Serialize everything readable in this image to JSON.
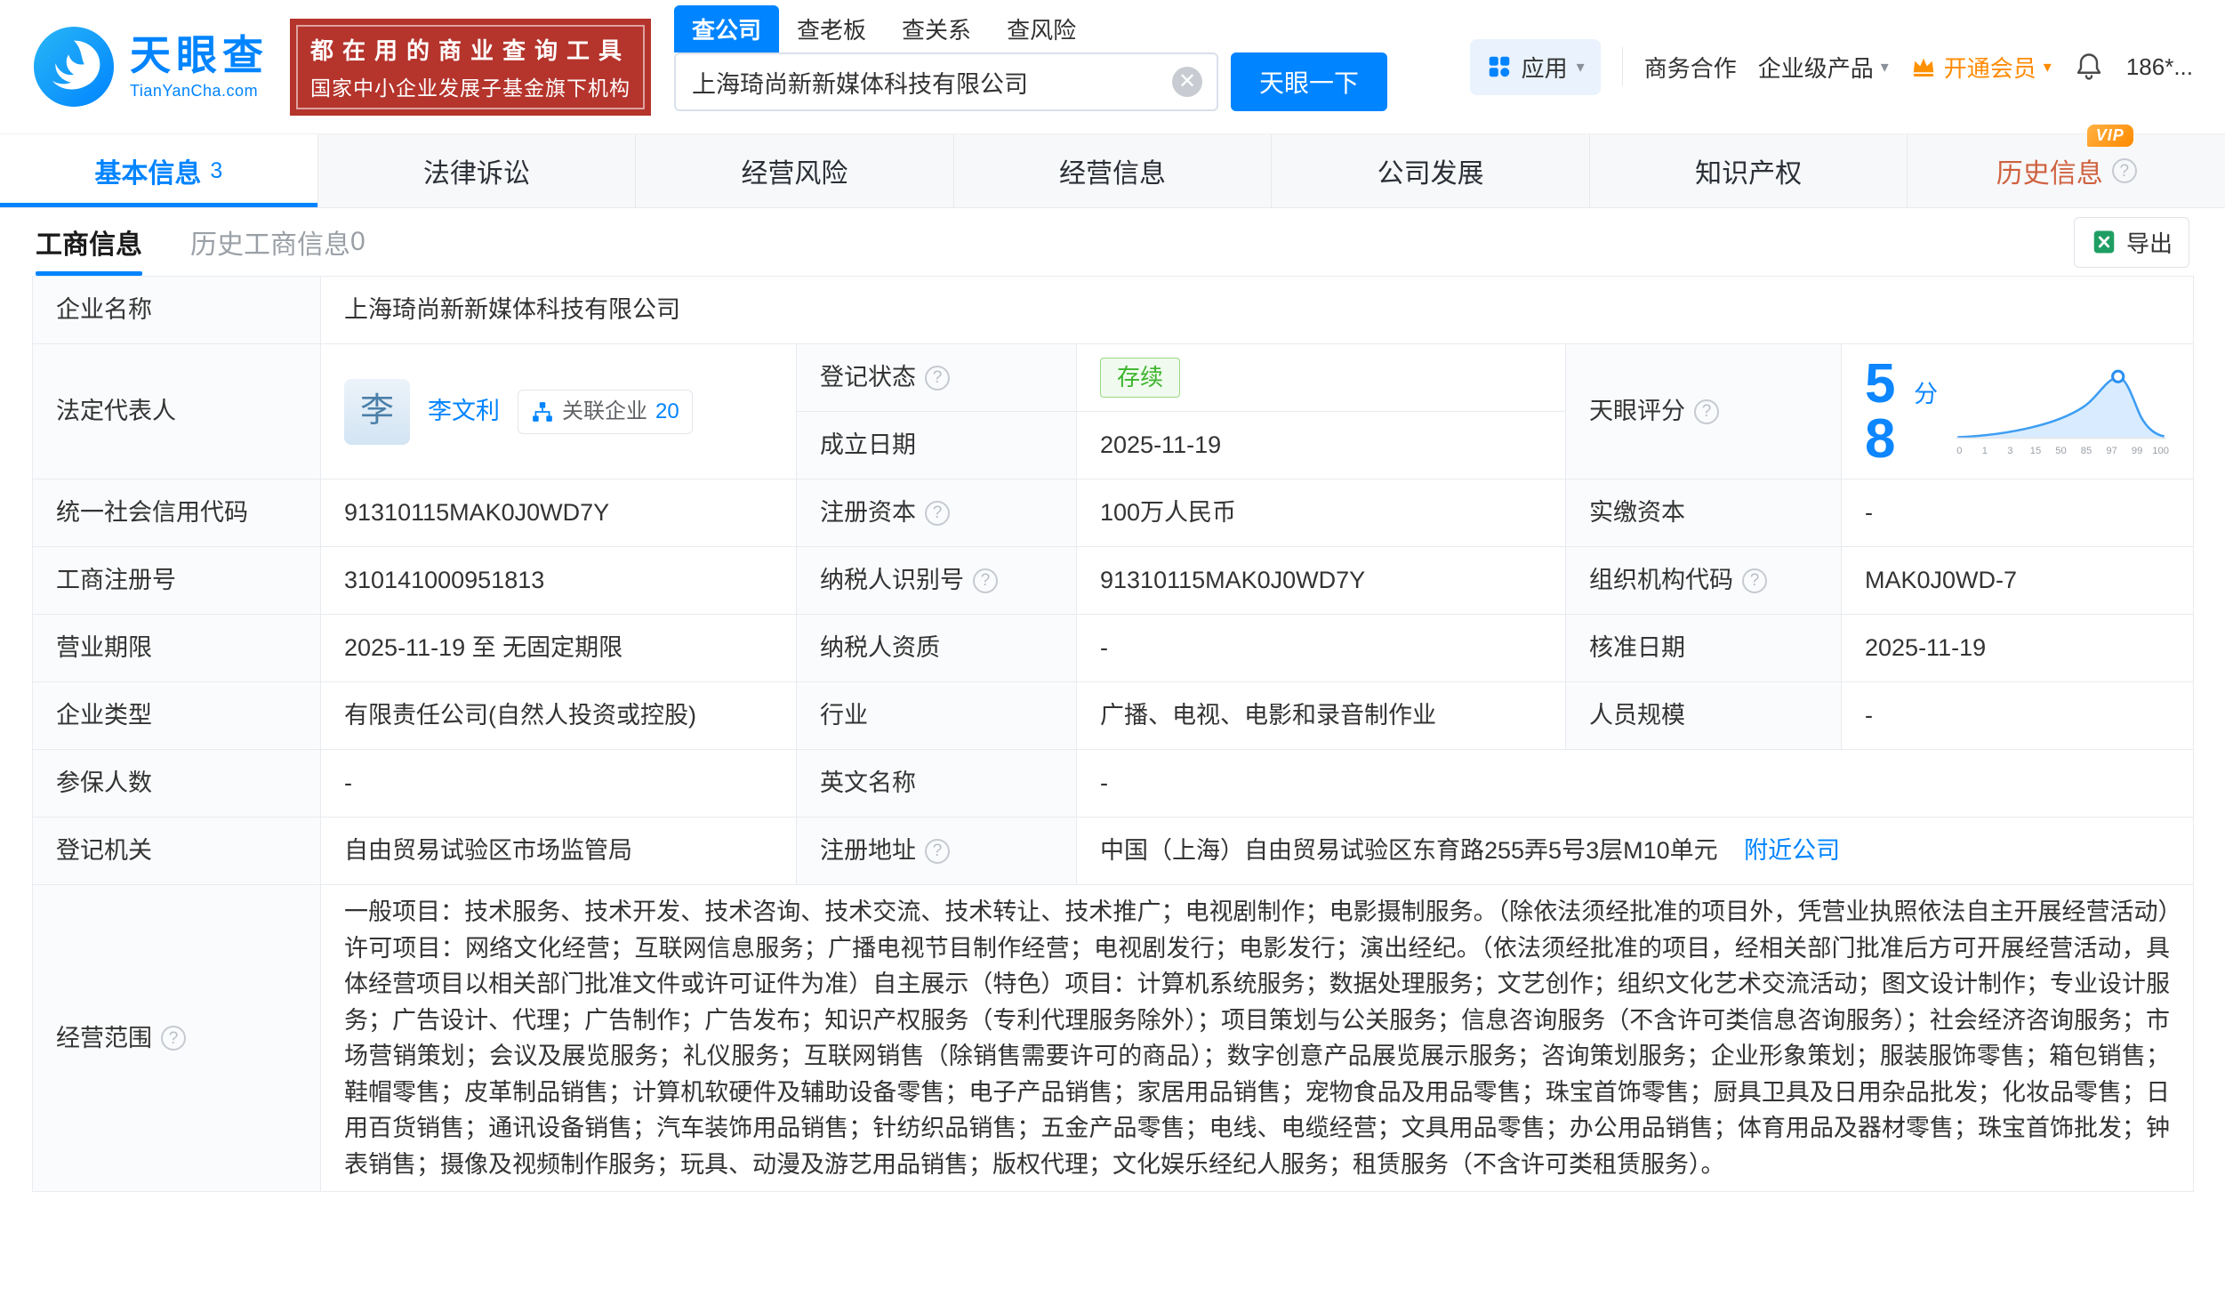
{
  "brand": {
    "name": "天眼查",
    "domain": "TianYanCha.com",
    "slogan_line1": "都在用的商业查询工具",
    "slogan_line2": "国家中小企业发展子基金旗下机构",
    "accent_color": "#0084ff",
    "slogan_bg_color": "#b5342c"
  },
  "icons": {
    "caret_down": "▾",
    "clear": "✕",
    "question": "?"
  },
  "search": {
    "tabs": [
      {
        "label": "查公司",
        "active": true
      },
      {
        "label": "查老板",
        "active": false
      },
      {
        "label": "查关系",
        "active": false
      },
      {
        "label": "查风险",
        "active": false
      }
    ],
    "value": "上海琦尚新新媒体科技有限公司",
    "button": "天眼一下"
  },
  "header_nav": {
    "apps": "应用",
    "cooperation": "商务合作",
    "enterprise_product": "企业级产品",
    "vip": "开通会员",
    "account": "186*..."
  },
  "main_tabs": [
    {
      "label": "基本信息",
      "count": "3",
      "active": true
    },
    {
      "label": "法律诉讼"
    },
    {
      "label": "经营风险"
    },
    {
      "label": "经营信息"
    },
    {
      "label": "公司发展"
    },
    {
      "label": "知识产权"
    },
    {
      "label": "历史信息",
      "badge": "VIP"
    }
  ],
  "sub_tabs": [
    {
      "label": "工商信息",
      "active": true
    },
    {
      "label": "历史工商信息",
      "count": "0",
      "active": false
    }
  ],
  "toolbar": {
    "export_label": "导出"
  },
  "company": {
    "name_label": "企业名称",
    "name": "上海琦尚新新媒体科技有限公司",
    "legal_rep_label": "法定代表人",
    "legal_rep_avatar": "李",
    "legal_rep_name": "李文利",
    "related_label": "关联企业",
    "related_count": "20",
    "reg_status_label": "登记状态",
    "reg_status": "存续",
    "establish_date_label": "成立日期",
    "establish_date": "2025-11-19",
    "score_label": "天眼评分",
    "score_value": "58",
    "score_unit": "分",
    "score_axis": [
      "0",
      "1",
      "3",
      "15",
      "50",
      "85",
      "97",
      "99",
      "100"
    ],
    "credit_code_label": "统一社会信用代码",
    "credit_code": "91310115MAK0J0WD7Y",
    "reg_capital_label": "注册资本",
    "reg_capital": "100万人民币",
    "paid_capital_label": "实缴资本",
    "paid_capital": "-",
    "reg_number_label": "工商注册号",
    "reg_number": "310141000951813",
    "taxpayer_id_label": "纳税人识别号",
    "taxpayer_id": "91310115MAK0J0WD7Y",
    "org_code_label": "组织机构代码",
    "org_code": "MAK0J0WD-7",
    "business_term_label": "营业期限",
    "business_term": "2025-11-19 至 无固定期限",
    "taxpayer_quality_label": "纳税人资质",
    "taxpayer_quality": "-",
    "approval_date_label": "核准日期",
    "approval_date": "2025-11-19",
    "company_type_label": "企业类型",
    "company_type": "有限责任公司(自然人投资或控股)",
    "industry_label": "行业",
    "industry": "广播、电视、电影和录音制作业",
    "staff_size_label": "人员规模",
    "staff_size": "-",
    "insured_label": "参保人数",
    "insured": "-",
    "english_name_label": "英文名称",
    "english_name": "-",
    "reg_authority_label": "登记机关",
    "reg_authority": "自由贸易试验区市场监管局",
    "address_label": "注册地址",
    "address": "中国（上海）自由贸易试验区东育路255弄5号3层M10单元",
    "nearby_link": "附近公司",
    "scope_label": "经营范围",
    "scope": "一般项目：技术服务、技术开发、技术咨询、技术交流、技术转让、技术推广；电视剧制作；电影摄制服务。（除依法须经批准的项目外，凭营业执照依法自主开展经营活动）许可项目：网络文化经营；互联网信息服务；广播电视节目制作经营；电视剧发行；电影发行；演出经纪。（依法须经批准的项目，经相关部门批准后方可开展经营活动，具体经营项目以相关部门批准文件或许可证件为准）自主展示（特色）项目：计算机系统服务；数据处理服务；文艺创作；组织文化艺术交流活动；图文设计制作；专业设计服务；广告设计、代理；广告制作；广告发布；知识产权服务（专利代理服务除外）；项目策划与公关服务；信息咨询服务（不含许可类信息咨询服务）；社会经济咨询服务；市场营销策划；会议及展览服务；礼仪服务；互联网销售（除销售需要许可的商品）；数字创意产品展览展示服务；咨询策划服务；企业形象策划；服装服饰零售；箱包销售；鞋帽零售；皮革制品销售；计算机软硬件及辅助设备零售；电子产品销售；家居用品销售；宠物食品及用品零售；珠宝首饰零售；厨具卫具及日用杂品批发；化妆品零售；日用百货销售；通讯设备销售；汽车装饰用品销售；针纺织品销售；五金产品零售；电线、电缆经营；文具用品零售；办公用品销售；体育用品及器材零售；珠宝首饰批发；钟表销售；摄像及视频制作服务；玩具、动漫及游艺用品销售；版权代理；文化娱乐经纪人服务；租赁服务（不含许可类租赁服务）。"
  }
}
